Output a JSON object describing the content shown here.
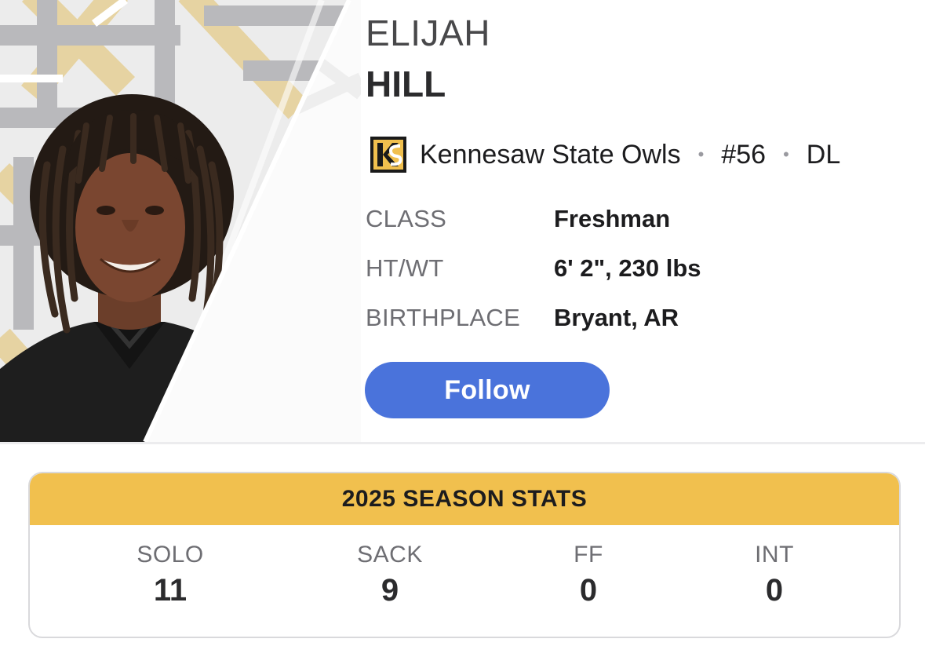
{
  "player": {
    "first_name": "ELIJAH",
    "last_name": "HILL"
  },
  "team": {
    "name": "Kennesaw State Owls",
    "logo_icon": "kennesaw-state-ks-logo",
    "number": "#56",
    "position": "DL",
    "separator": "•"
  },
  "details": [
    {
      "label": "CLASS",
      "value": "Freshman"
    },
    {
      "label": "HT/WT",
      "value": "6' 2\", 230 lbs"
    },
    {
      "label": "BIRTHPLACE",
      "value": "Bryant, AR"
    }
  ],
  "follow_label": "Follow",
  "stats": {
    "title": "2025 SEASON STATS",
    "items": [
      {
        "label": "SOLO",
        "value": "11"
      },
      {
        "label": "SACK",
        "value": "9"
      },
      {
        "label": "FF",
        "value": "0"
      },
      {
        "label": "INT",
        "value": "0"
      }
    ]
  },
  "colors": {
    "accent_gold": "#f1c04e",
    "follow_blue": "#4a73db",
    "pattern_gray": "#b8b8bc",
    "pattern_gold": "#e8d4a4"
  }
}
